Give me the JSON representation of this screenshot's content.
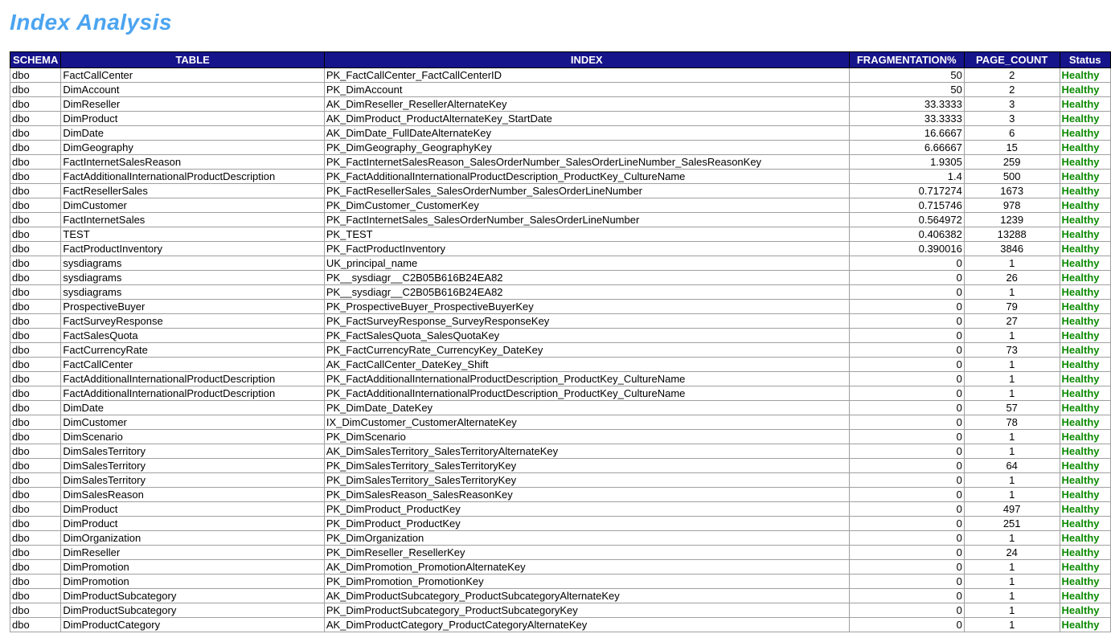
{
  "title": "Index Analysis",
  "columns": [
    "SCHEMA",
    "TABLE",
    "INDEX",
    "FRAGMENTATION%",
    "PAGE_COUNT",
    "Status"
  ],
  "rows": [
    {
      "schema": "dbo",
      "table": "FactCallCenter",
      "index": "PK_FactCallCenter_FactCallCenterID",
      "frag": "50",
      "pages": "2",
      "status": "Healthy"
    },
    {
      "schema": "dbo",
      "table": "DimAccount",
      "index": "PK_DimAccount",
      "frag": "50",
      "pages": "2",
      "status": "Healthy"
    },
    {
      "schema": "dbo",
      "table": "DimReseller",
      "index": "AK_DimReseller_ResellerAlternateKey",
      "frag": "33.3333",
      "pages": "3",
      "status": "Healthy"
    },
    {
      "schema": "dbo",
      "table": "DimProduct",
      "index": "AK_DimProduct_ProductAlternateKey_StartDate",
      "frag": "33.3333",
      "pages": "3",
      "status": "Healthy"
    },
    {
      "schema": "dbo",
      "table": "DimDate",
      "index": "AK_DimDate_FullDateAlternateKey",
      "frag": "16.6667",
      "pages": "6",
      "status": "Healthy"
    },
    {
      "schema": "dbo",
      "table": "DimGeography",
      "index": "PK_DimGeography_GeographyKey",
      "frag": "6.66667",
      "pages": "15",
      "status": "Healthy"
    },
    {
      "schema": "dbo",
      "table": "FactInternetSalesReason",
      "index": "PK_FactInternetSalesReason_SalesOrderNumber_SalesOrderLineNumber_SalesReasonKey",
      "frag": "1.9305",
      "pages": "259",
      "status": "Healthy"
    },
    {
      "schema": "dbo",
      "table": "FactAdditionalInternationalProductDescription",
      "index": "PK_FactAdditionalInternationalProductDescription_ProductKey_CultureName",
      "frag": "1.4",
      "pages": "500",
      "status": "Healthy"
    },
    {
      "schema": "dbo",
      "table": "FactResellerSales",
      "index": "PK_FactResellerSales_SalesOrderNumber_SalesOrderLineNumber",
      "frag": "0.717274",
      "pages": "1673",
      "status": "Healthy"
    },
    {
      "schema": "dbo",
      "table": "DimCustomer",
      "index": "PK_DimCustomer_CustomerKey",
      "frag": "0.715746",
      "pages": "978",
      "status": "Healthy"
    },
    {
      "schema": "dbo",
      "table": "FactInternetSales",
      "index": "PK_FactInternetSales_SalesOrderNumber_SalesOrderLineNumber",
      "frag": "0.564972",
      "pages": "1239",
      "status": "Healthy"
    },
    {
      "schema": "dbo",
      "table": "TEST",
      "index": "PK_TEST",
      "frag": "0.406382",
      "pages": "13288",
      "status": "Healthy"
    },
    {
      "schema": "dbo",
      "table": "FactProductInventory",
      "index": "PK_FactProductInventory",
      "frag": "0.390016",
      "pages": "3846",
      "status": "Healthy"
    },
    {
      "schema": "dbo",
      "table": "sysdiagrams",
      "index": "UK_principal_name",
      "frag": "0",
      "pages": "1",
      "status": "Healthy"
    },
    {
      "schema": "dbo",
      "table": "sysdiagrams",
      "index": "PK__sysdiagr__C2B05B616B24EA82",
      "frag": "0",
      "pages": "26",
      "status": "Healthy"
    },
    {
      "schema": "dbo",
      "table": "sysdiagrams",
      "index": "PK__sysdiagr__C2B05B616B24EA82",
      "frag": "0",
      "pages": "1",
      "status": "Healthy"
    },
    {
      "schema": "dbo",
      "table": "ProspectiveBuyer",
      "index": "PK_ProspectiveBuyer_ProspectiveBuyerKey",
      "frag": "0",
      "pages": "79",
      "status": "Healthy"
    },
    {
      "schema": "dbo",
      "table": "FactSurveyResponse",
      "index": "PK_FactSurveyResponse_SurveyResponseKey",
      "frag": "0",
      "pages": "27",
      "status": "Healthy"
    },
    {
      "schema": "dbo",
      "table": "FactSalesQuota",
      "index": "PK_FactSalesQuota_SalesQuotaKey",
      "frag": "0",
      "pages": "1",
      "status": "Healthy"
    },
    {
      "schema": "dbo",
      "table": "FactCurrencyRate",
      "index": "PK_FactCurrencyRate_CurrencyKey_DateKey",
      "frag": "0",
      "pages": "73",
      "status": "Healthy"
    },
    {
      "schema": "dbo",
      "table": "FactCallCenter",
      "index": "AK_FactCallCenter_DateKey_Shift",
      "frag": "0",
      "pages": "1",
      "status": "Healthy"
    },
    {
      "schema": "dbo",
      "table": "FactAdditionalInternationalProductDescription",
      "index": "PK_FactAdditionalInternationalProductDescription_ProductKey_CultureName",
      "frag": "0",
      "pages": "1",
      "status": "Healthy"
    },
    {
      "schema": "dbo",
      "table": "FactAdditionalInternationalProductDescription",
      "index": "PK_FactAdditionalInternationalProductDescription_ProductKey_CultureName",
      "frag": "0",
      "pages": "1",
      "status": "Healthy"
    },
    {
      "schema": "dbo",
      "table": "DimDate",
      "index": "PK_DimDate_DateKey",
      "frag": "0",
      "pages": "57",
      "status": "Healthy"
    },
    {
      "schema": "dbo",
      "table": "DimCustomer",
      "index": "IX_DimCustomer_CustomerAlternateKey",
      "frag": "0",
      "pages": "78",
      "status": "Healthy"
    },
    {
      "schema": "dbo",
      "table": "DimScenario",
      "index": "PK_DimScenario",
      "frag": "0",
      "pages": "1",
      "status": "Healthy"
    },
    {
      "schema": "dbo",
      "table": "DimSalesTerritory",
      "index": "AK_DimSalesTerritory_SalesTerritoryAlternateKey",
      "frag": "0",
      "pages": "1",
      "status": "Healthy"
    },
    {
      "schema": "dbo",
      "table": "DimSalesTerritory",
      "index": "PK_DimSalesTerritory_SalesTerritoryKey",
      "frag": "0",
      "pages": "64",
      "status": "Healthy"
    },
    {
      "schema": "dbo",
      "table": "DimSalesTerritory",
      "index": "PK_DimSalesTerritory_SalesTerritoryKey",
      "frag": "0",
      "pages": "1",
      "status": "Healthy"
    },
    {
      "schema": "dbo",
      "table": "DimSalesReason",
      "index": "PK_DimSalesReason_SalesReasonKey",
      "frag": "0",
      "pages": "1",
      "status": "Healthy"
    },
    {
      "schema": "dbo",
      "table": "DimProduct",
      "index": "PK_DimProduct_ProductKey",
      "frag": "0",
      "pages": "497",
      "status": "Healthy"
    },
    {
      "schema": "dbo",
      "table": "DimProduct",
      "index": "PK_DimProduct_ProductKey",
      "frag": "0",
      "pages": "251",
      "status": "Healthy"
    },
    {
      "schema": "dbo",
      "table": "DimOrganization",
      "index": "PK_DimOrganization",
      "frag": "0",
      "pages": "1",
      "status": "Healthy"
    },
    {
      "schema": "dbo",
      "table": "DimReseller",
      "index": "PK_DimReseller_ResellerKey",
      "frag": "0",
      "pages": "24",
      "status": "Healthy"
    },
    {
      "schema": "dbo",
      "table": "DimPromotion",
      "index": "AK_DimPromotion_PromotionAlternateKey",
      "frag": "0",
      "pages": "1",
      "status": "Healthy"
    },
    {
      "schema": "dbo",
      "table": "DimPromotion",
      "index": "PK_DimPromotion_PromotionKey",
      "frag": "0",
      "pages": "1",
      "status": "Healthy"
    },
    {
      "schema": "dbo",
      "table": "DimProductSubcategory",
      "index": "AK_DimProductSubcategory_ProductSubcategoryAlternateKey",
      "frag": "0",
      "pages": "1",
      "status": "Healthy"
    },
    {
      "schema": "dbo",
      "table": "DimProductSubcategory",
      "index": "PK_DimProductSubcategory_ProductSubcategoryKey",
      "frag": "0",
      "pages": "1",
      "status": "Healthy"
    },
    {
      "schema": "dbo",
      "table": "DimProductCategory",
      "index": "AK_DimProductCategory_ProductCategoryAlternateKey",
      "frag": "0",
      "pages": "1",
      "status": "Healthy"
    }
  ]
}
